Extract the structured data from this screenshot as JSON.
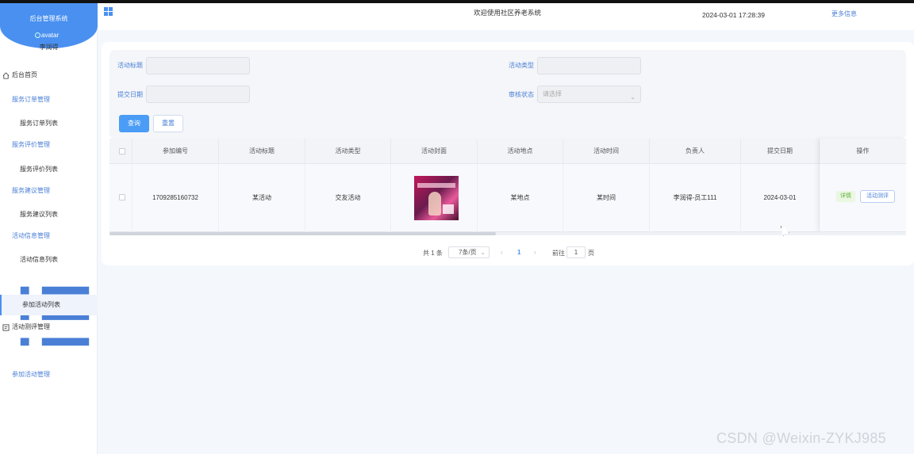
{
  "sidebar": {
    "brand_title": "后台管理系统",
    "avatar_alt": "avatar",
    "username": "李润得",
    "menu": [
      {
        "label": "后台首页",
        "type": "top",
        "icon": "home-icon"
      },
      {
        "label": "服务订单管理",
        "type": "group"
      },
      {
        "label": "服务订单列表",
        "type": "sub"
      },
      {
        "label": "服务评价管理",
        "type": "group"
      },
      {
        "label": "服务评价列表",
        "type": "sub"
      },
      {
        "label": "服务建议管理",
        "type": "group"
      },
      {
        "label": "服务建议列表",
        "type": "sub"
      },
      {
        "label": "活动信息管理",
        "type": "group"
      },
      {
        "label": "活动信息列表",
        "type": "sub"
      },
      {
        "label": "参加活动管理",
        "type": "top-open",
        "icon": "list-icon"
      },
      {
        "label": "参加活动列表",
        "type": "active"
      },
      {
        "label": "活动测评管理",
        "type": "top",
        "icon": "form-icon"
      }
    ]
  },
  "header": {
    "title": "欢迎使用社区养老系统",
    "datetime": "2024-03-01 17:28:39",
    "more_info": "更多信息"
  },
  "search": {
    "title_label": "活动标题",
    "type_label": "活动类型",
    "date_label": "提交日期",
    "status_label": "审核状态",
    "status_placeholder": "请选择",
    "query_button": "查询",
    "reset_button": "重置"
  },
  "table": {
    "columns": [
      "参加编号",
      "活动标题",
      "活动类型",
      "活动封面",
      "活动地点",
      "活动时间",
      "负责人",
      "提交日期",
      "操作"
    ],
    "rows": [
      {
        "id": "1709285160732",
        "title": "某活动",
        "type": "交友活动",
        "location": "某地点",
        "time": "某时间",
        "owner": "李润得-员工111",
        "date": "2024-03-01",
        "detail_label": "详情",
        "review_label": "活动测评"
      }
    ]
  },
  "pagination": {
    "total": "共 1 条",
    "page_size": "7条/页",
    "prev": "‹",
    "current": "1",
    "next": "›",
    "goto": "前往",
    "jump_value": "1",
    "page_suffix": "页"
  },
  "watermark": "CSDN @Weixin-ZYKJ985",
  "colors": {
    "brand": "#4a90f0",
    "link": "#4a7fd6",
    "success_tag": "#5fb13a",
    "background": "#f4f8fd"
  }
}
